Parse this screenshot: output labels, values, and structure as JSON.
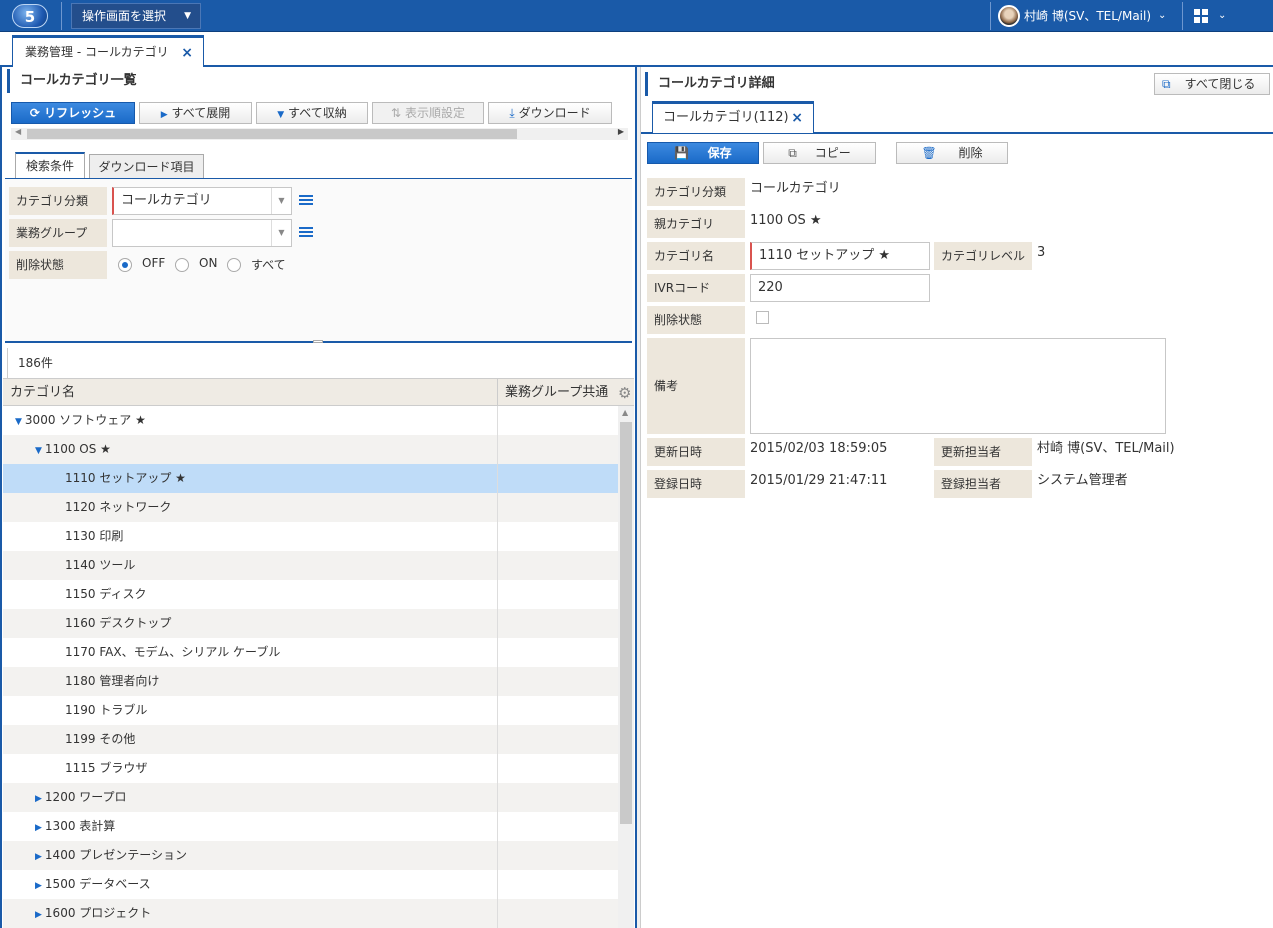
{
  "topbar": {
    "logo": "5",
    "screen_select": "操作画面を選択",
    "user": "村崎 博(SV、TEL/Mail)"
  },
  "main_tab": {
    "label": "業務管理 - コールカテゴリ",
    "close": "×"
  },
  "left": {
    "title": "コールカテゴリ一覧",
    "toolbar": {
      "refresh": "リフレッシュ",
      "expand_all": "すべて展開",
      "collapse_all": "すべて収納",
      "sort_settings": "表示順設定",
      "download": "ダウンロード"
    },
    "subtabs": {
      "search": "検索条件",
      "download_items": "ダウンロード項目"
    },
    "search": {
      "category_type_label": "カテゴリ分類",
      "category_type_value": "コールカテゴリ",
      "group_label": "業務グループ",
      "group_value": "",
      "delete_status_label": "削除状態",
      "options": [
        "OFF",
        "ON",
        "すべて"
      ],
      "selected_option": "OFF"
    },
    "count": "186件",
    "table": {
      "col_name": "カテゴリ名",
      "col_group": "業務グループ共通",
      "rows": [
        {
          "label": "3000 ソフトウェア ★",
          "level": 0,
          "toggle": "▼",
          "selected": false
        },
        {
          "label": "1100 OS ★",
          "level": 1,
          "toggle": "▼",
          "selected": false
        },
        {
          "label": "1110 セットアップ ★",
          "level": 2,
          "toggle": "",
          "selected": true
        },
        {
          "label": "1120 ネットワーク",
          "level": 2,
          "toggle": "",
          "selected": false
        },
        {
          "label": "1130 印刷",
          "level": 2,
          "toggle": "",
          "selected": false
        },
        {
          "label": "1140 ツール",
          "level": 2,
          "toggle": "",
          "selected": false
        },
        {
          "label": "1150 ディスク",
          "level": 2,
          "toggle": "",
          "selected": false
        },
        {
          "label": "1160 デスクトップ",
          "level": 2,
          "toggle": "",
          "selected": false
        },
        {
          "label": "1170 FAX、モデム、シリアル ケーブル",
          "level": 2,
          "toggle": "",
          "selected": false
        },
        {
          "label": "1180 管理者向け",
          "level": 2,
          "toggle": "",
          "selected": false
        },
        {
          "label": "1190 トラブル",
          "level": 2,
          "toggle": "",
          "selected": false
        },
        {
          "label": "1199 その他",
          "level": 2,
          "toggle": "",
          "selected": false
        },
        {
          "label": "1115 ブラウザ",
          "level": 2,
          "toggle": "",
          "selected": false
        },
        {
          "label": "1200 ワープロ",
          "level": 1,
          "toggle": "▶",
          "selected": false
        },
        {
          "label": "1300 表計算",
          "level": 1,
          "toggle": "▶",
          "selected": false
        },
        {
          "label": "1400 プレゼンテーション",
          "level": 1,
          "toggle": "▶",
          "selected": false
        },
        {
          "label": "1500 データベース",
          "level": 1,
          "toggle": "▶",
          "selected": false
        },
        {
          "label": "1600 プロジェクト",
          "level": 1,
          "toggle": "▶",
          "selected": false
        }
      ]
    }
  },
  "right": {
    "title": "コールカテゴリ詳細",
    "close_all": "すべて閉じる",
    "detail_tab": {
      "label": "コールカテゴリ(112)",
      "close": "×"
    },
    "toolbar": {
      "save": "保存",
      "copy": "コピー",
      "delete": "削除"
    },
    "fields": {
      "category_type_label": "カテゴリ分類",
      "category_type_value": "コールカテゴリ",
      "parent_label": "親カテゴリ",
      "parent_value": "1100 OS ★",
      "name_label": "カテゴリ名",
      "name_value": "1110 セットアップ ★",
      "level_label": "カテゴリレベル",
      "level_value": "3",
      "ivr_label": "IVRコード",
      "ivr_value": "220",
      "deleted_label": "削除状態",
      "note_label": "備考",
      "updated_label": "更新日時",
      "updated_value": "2015/02/03 18:59:05",
      "updated_by_label": "更新担当者",
      "updated_by_value": "村崎 博(SV、TEL/Mail)",
      "created_label": "登録日時",
      "created_value": "2015/01/29 21:47:11",
      "created_by_label": "登録担当者",
      "created_by_value": "システム管理者"
    }
  }
}
